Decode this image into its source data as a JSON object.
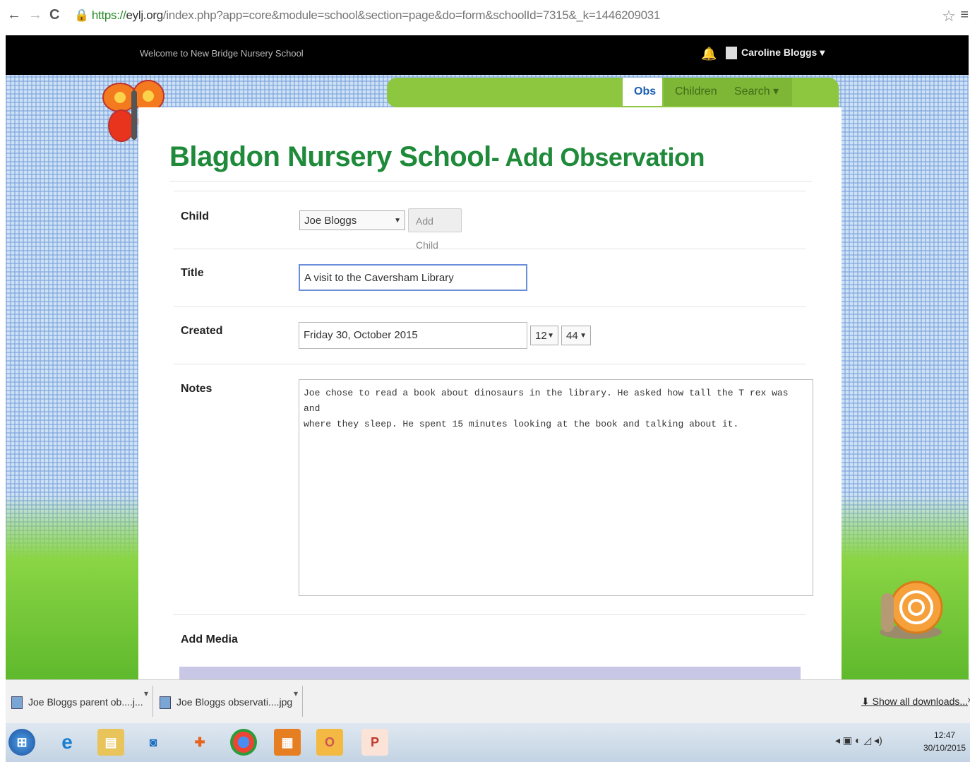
{
  "browser": {
    "url_scheme": "https://",
    "url_domain": "eylj.org",
    "url_path": "/index.php?app=core&module=school&section=page&do=form&schoolId=7315&_k=1446209031"
  },
  "header": {
    "welcome": "Welcome to New Bridge Nursery School",
    "user_name": "Caroline Bloggs"
  },
  "nav": {
    "tabs": [
      "Obs",
      "Children",
      "Search"
    ]
  },
  "page": {
    "title": "Blagdon Nursery School",
    "subtitle": "- Add Observation"
  },
  "form": {
    "child_label": "Child",
    "child_value": "Joe Bloggs",
    "add_child_label": "Add Child",
    "title_label": "Title",
    "title_value": "A visit to the Caversham Library",
    "created_label": "Created",
    "created_date": "Friday 30, October 2015",
    "created_hour": "12",
    "created_minute": "44",
    "notes_label": "Notes",
    "notes_value": "Joe chose to read a book about dinosaurs in the library. He asked how tall the T rex was and\nwhere they sleep. He spent 15 minutes looking at the book and talking about it.",
    "add_media_label": "Add Media"
  },
  "downloads": {
    "items": [
      "Joe Bloggs parent ob....j...",
      "Joe Bloggs observati....jpg"
    ],
    "show_all": "Show all downloads..."
  },
  "taskbar": {
    "clock_time": "12:47",
    "clock_date": "30/10/2015"
  },
  "colors": {
    "title_green": "#1e8a3a",
    "nav_green": "#8dc63f",
    "header_black": "#000000"
  }
}
